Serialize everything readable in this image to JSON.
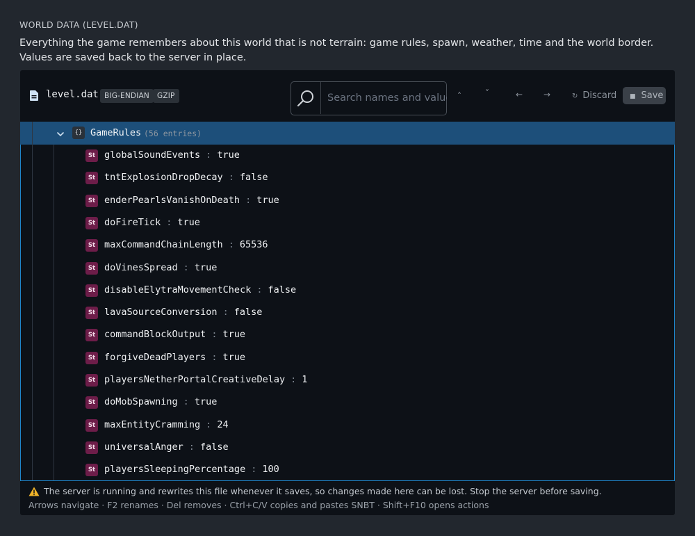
{
  "section": {
    "title": "WORLD DATA (LEVEL.DAT)",
    "description": "Everything the game remembers about this world that is not terrain: game rules, spawn, weather, time and the world border. Values are saved back to the server in place."
  },
  "toolbar": {
    "file_name": "level.dat",
    "badges": [
      "BIG-ENDIAN",
      "GZIP"
    ],
    "search_placeholder": "Search names and values",
    "prev_match": "˄",
    "next_match": "˅",
    "back": "←",
    "forward": "→",
    "discard_label": "Discard",
    "save_label": "Save"
  },
  "tree": {
    "compound_type": "{}",
    "compound_name": "GameRules",
    "compound_count": "(56 entries)",
    "tag_type": "St",
    "entries": [
      {
        "key": "globalSoundEvents",
        "value": "true"
      },
      {
        "key": "tntExplosionDropDecay",
        "value": "false"
      },
      {
        "key": "enderPearlsVanishOnDeath",
        "value": "true"
      },
      {
        "key": "doFireTick",
        "value": "true"
      },
      {
        "key": "maxCommandChainLength",
        "value": "65536"
      },
      {
        "key": "doVinesSpread",
        "value": "true"
      },
      {
        "key": "disableElytraMovementCheck",
        "value": "false"
      },
      {
        "key": "lavaSourceConversion",
        "value": "false"
      },
      {
        "key": "commandBlockOutput",
        "value": "true"
      },
      {
        "key": "forgiveDeadPlayers",
        "value": "true"
      },
      {
        "key": "playersNetherPortalCreativeDelay",
        "value": "1"
      },
      {
        "key": "doMobSpawning",
        "value": "true"
      },
      {
        "key": "maxEntityCramming",
        "value": "24"
      },
      {
        "key": "universalAnger",
        "value": "false"
      },
      {
        "key": "playersSleepingPercentage",
        "value": "100"
      }
    ]
  },
  "footer": {
    "warning": "The server is running and rewrites this file whenever it saves, so changes made here can be lost. Stop the server before saving.",
    "shortcuts": "Arrows navigate · F2 renames · Del removes · Ctrl+C/V copies and pastes SNBT · Shift+F10 opens actions"
  },
  "colors": {
    "background": "#22272e",
    "editor_bg": "#0d1117",
    "selected_row": "#1d4f7a",
    "focus_border": "#1f85c9",
    "string_tag": "#6d1d49",
    "warning": "#f0b429"
  },
  "icons": {
    "file": "file-document-icon",
    "search": "search-icon",
    "expand": "chevron-down-icon",
    "warning": "warning-triangle-icon",
    "discard": "revert-icon",
    "save": "floppy-disk-icon"
  }
}
